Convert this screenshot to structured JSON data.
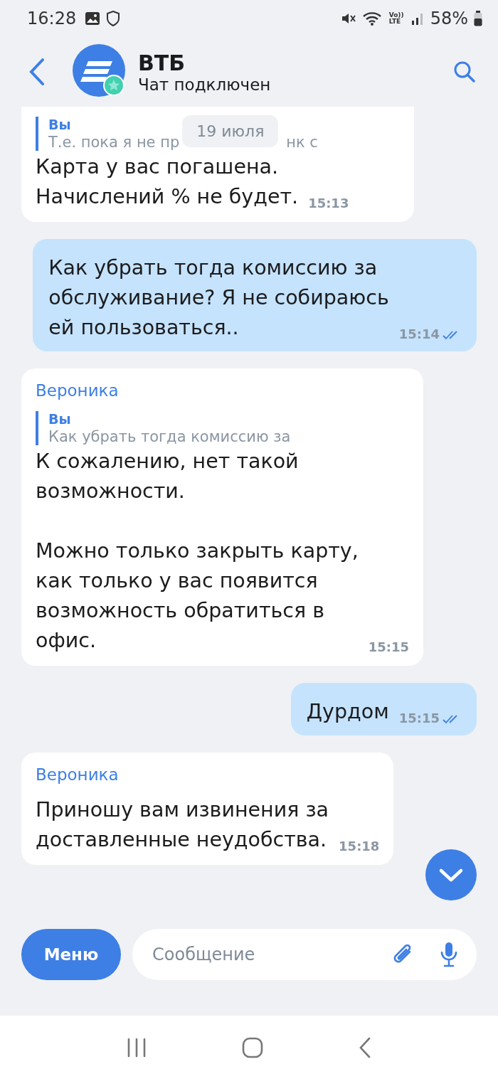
{
  "status_bar": {
    "time": "16:28",
    "battery": "58%",
    "network": "Vo)) LTE"
  },
  "header": {
    "title": "ВТБ",
    "subtitle": "Чат подключен"
  },
  "date_chip": "19 июля",
  "messages": [
    {
      "kind": "incoming",
      "cut_top": true,
      "quote": {
        "author": "Вы",
        "parts": [
          "Т.е. пока я не пр",
          "нк с"
        ]
      },
      "text": "Карта у вас погашена.\nНачислений % не будет.",
      "time": "15:13"
    },
    {
      "kind": "outgoing",
      "text": "Как убрать тогда комиссию за\nобслуживание? Я не собираюсь\nей пользоваться..",
      "time": "15:14",
      "read": true
    },
    {
      "kind": "incoming",
      "cut_top": false,
      "sender": "Вероника",
      "quote": {
        "author": "Вы",
        "parts": [
          "Как убрать тогда комиссию за"
        ]
      },
      "text": "К сожалению, нет такой\nвозможности.\n\nМожно только закрыть карту,\nкак только у вас появится\nвозможность обратиться в\nофис.",
      "time": "15:15"
    },
    {
      "kind": "outgoing",
      "text": "Дурдом",
      "time": "15:15",
      "read": true
    },
    {
      "kind": "incoming",
      "cut_top": false,
      "sender": "Вероника",
      "text": "Приношу вам извинения за\nдоставленные неудобства.",
      "time": "15:18"
    }
  ],
  "composer": {
    "menu_button": "Меню",
    "placeholder": "Сообщение"
  }
}
